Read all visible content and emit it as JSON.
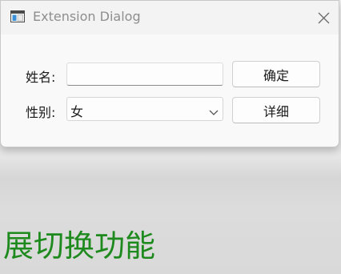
{
  "window": {
    "title": "Extension Dialog",
    "icon": "app-window-icon",
    "close_icon": "close-icon"
  },
  "form": {
    "name_label": "姓名:",
    "name_value": "",
    "gender_label": "性别:",
    "gender_value": "女",
    "dropdown_icon": "chevron-down-icon"
  },
  "buttons": {
    "ok": "确定",
    "details": "详细"
  },
  "background": {
    "caption": "展切换功能",
    "caption_color": "#1e8a1e"
  }
}
